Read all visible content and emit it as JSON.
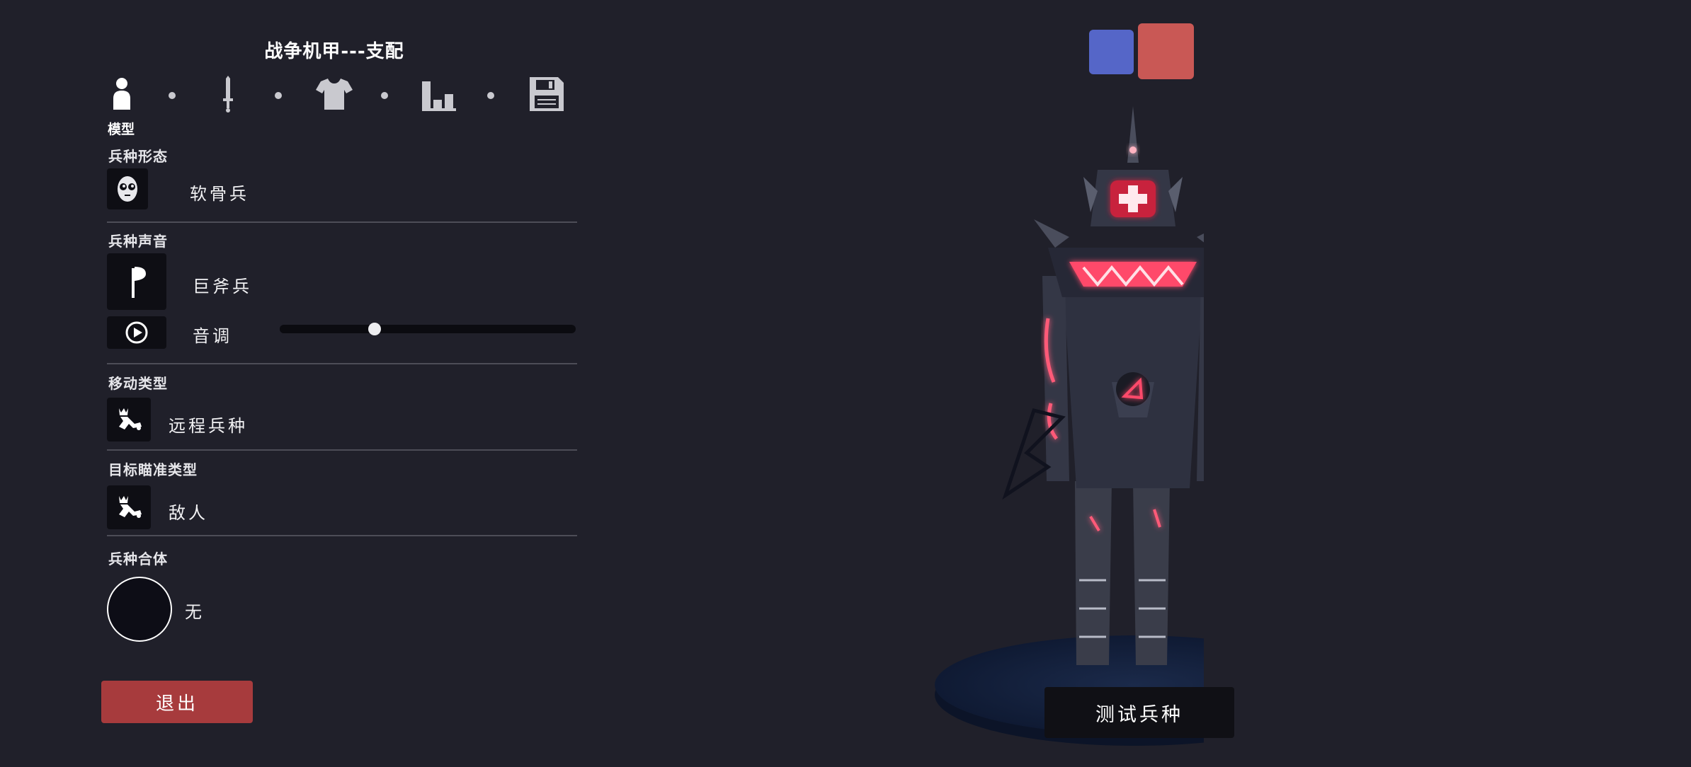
{
  "unit_title": "战争机甲---支配",
  "steps": {
    "items": [
      {
        "name": "model",
        "icon": "person-icon",
        "active": true
      },
      {
        "name": "weapon",
        "icon": "sword-icon",
        "active": false
      },
      {
        "name": "clothing",
        "icon": "shirt-icon",
        "active": false
      },
      {
        "name": "stats",
        "icon": "bar-chart-icon",
        "active": false
      },
      {
        "name": "save",
        "icon": "floppy-disk-icon",
        "active": false
      }
    ],
    "current_label": "模型"
  },
  "form": {
    "label": "兵种形态",
    "icon": "mask-face-icon",
    "value": "软骨兵"
  },
  "voice": {
    "label": "兵种声音",
    "icon": "axe-icon",
    "value": "巨斧兵",
    "play_icon": "play-icon",
    "pitch_label": "音调",
    "pitch_level": 0.32
  },
  "movement": {
    "label": "移动类型",
    "icon": "crown-figure-icon",
    "value": "远程兵种"
  },
  "targeting": {
    "label": "目标瞄准类型",
    "icon": "crown-figure-icon",
    "value": "敌人"
  },
  "combine": {
    "label": "兵种合体",
    "value": "无"
  },
  "exit_button": "退出",
  "test_button": "测试兵种",
  "team_colors": {
    "blue": "#5566c8",
    "red": "#c95855"
  },
  "colors": {
    "background": "#20202a",
    "exit_button": "#a73b3d",
    "glow": "#ff3a5a"
  }
}
